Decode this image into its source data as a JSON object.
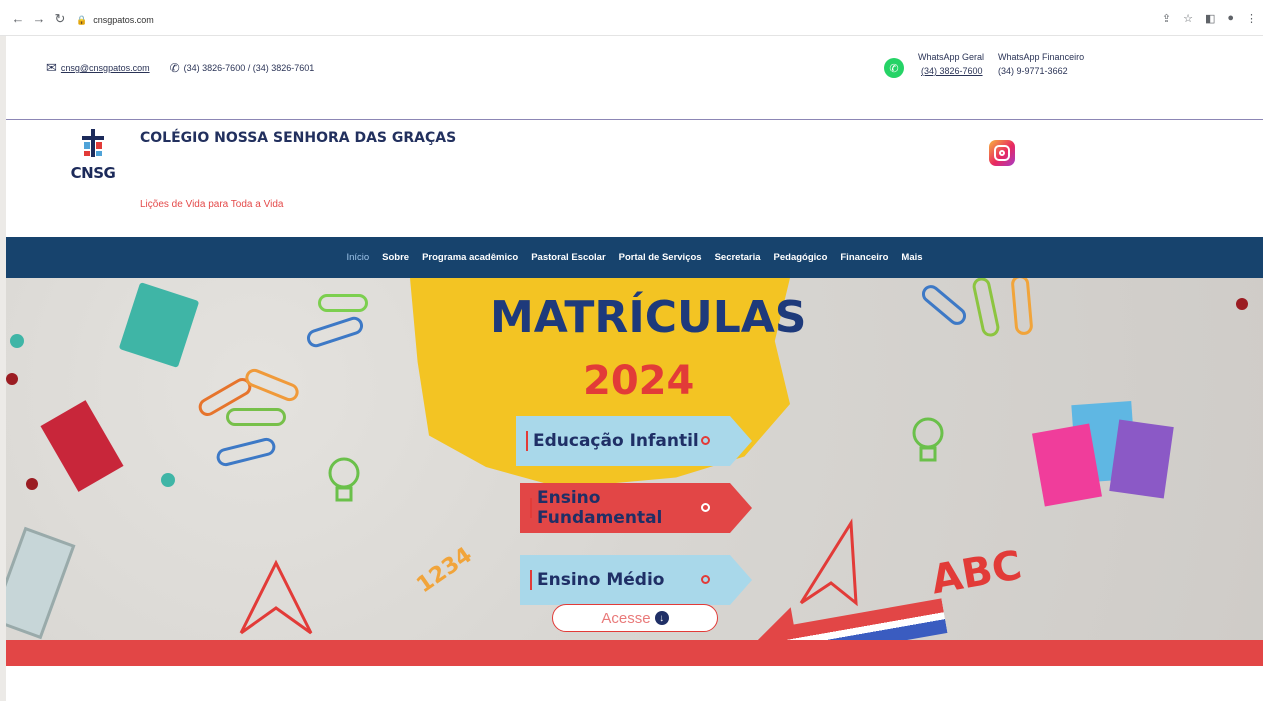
{
  "browser": {
    "url": "cnsgpatos.com",
    "back_icon": "back-arrow-icon",
    "forward_icon": "forward-arrow-icon",
    "reload_icon": "reload-icon"
  },
  "contact": {
    "email": "cnsg@cnsgpatos.com",
    "phone": "(34) 3826-7600 / (34) 3826-7601"
  },
  "whatsapp": {
    "geral_label": "WhatsApp Geral",
    "geral_number": "(34) 3826-7600",
    "financeiro_label": "WhatsApp Financeiro",
    "financeiro_number": "(34) 9-9771-3662"
  },
  "header": {
    "logo_text": "CNSG",
    "school_name": "COLÉGIO NOSSA SENHORA DAS GRAÇAS",
    "slogan": "Lições de Vida para Toda a Vida"
  },
  "menu": [
    {
      "label": "Início"
    },
    {
      "label": "Sobre"
    },
    {
      "label": "Programa acadêmico"
    },
    {
      "label": "Pastoral Escolar"
    },
    {
      "label": "Portal de Serviços"
    },
    {
      "label": "Secretaria"
    },
    {
      "label": "Pedagógico"
    },
    {
      "label": "Financeiro"
    },
    {
      "label": "Mais"
    }
  ],
  "banner": {
    "title": "MATRÍCULAS",
    "year": "2024",
    "options": [
      "Educação Infantil",
      "Ensino Fundamental",
      "Ensino Médio"
    ],
    "cta": "Acesse",
    "decor_numbers": "1234",
    "decor_letters": "ABC"
  },
  "colors": {
    "navy": "#17436d",
    "red": "#e24646",
    "yellow": "#f3c423",
    "light_blue": "#a9d8ea"
  }
}
